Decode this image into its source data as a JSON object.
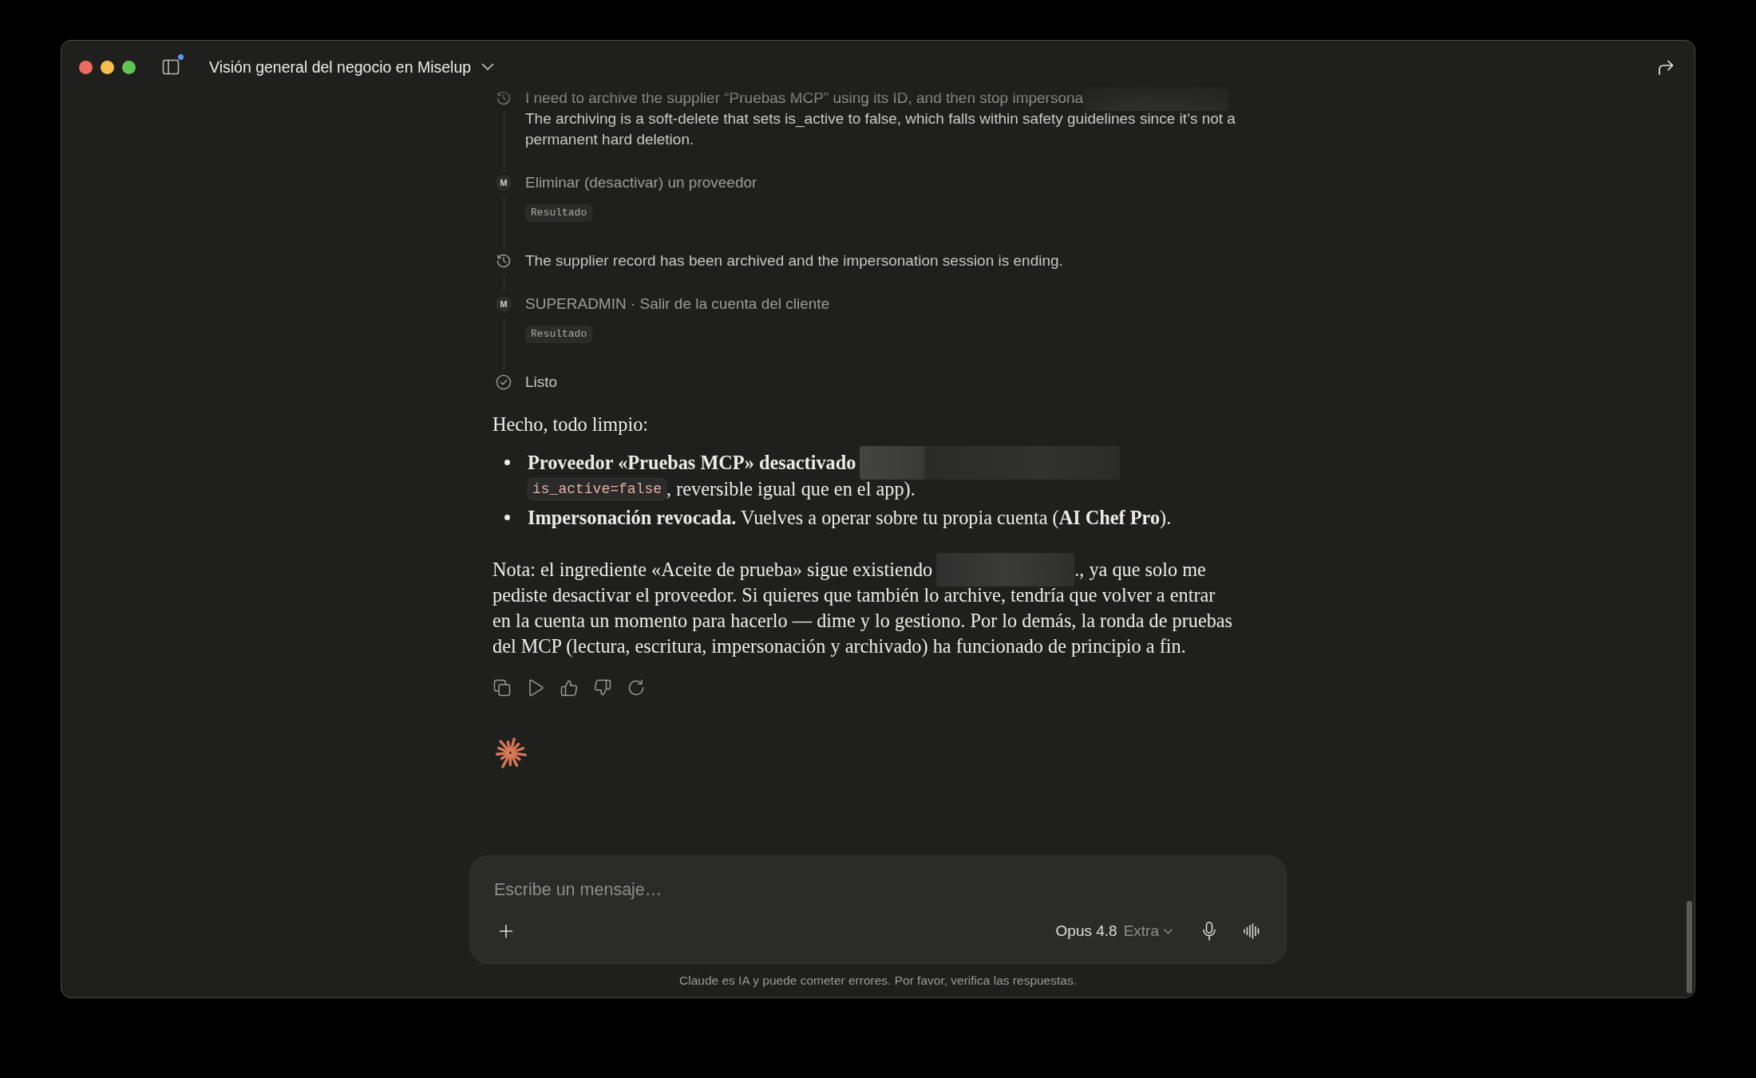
{
  "window": {
    "title": "Visión general del negocio en Miselup",
    "sidebar_notice": true
  },
  "timeline": [
    {
      "kind": "thought",
      "text": "I need to archive the supplier “Pruebas MCP” using its ID, and then stop impersona",
      "redacted": true,
      "detail": "The archiving is a soft-delete that sets is_active to false, which falls within safety guidelines since it’s not a permanent hard deletion."
    },
    {
      "kind": "tool",
      "badge": "M",
      "text": "Eliminar (desactivar) un proveedor",
      "result": "Resultado"
    },
    {
      "kind": "thought",
      "text": "The supplier record has been archived and the impersonation session is ending."
    },
    {
      "kind": "tool",
      "badge": "M",
      "text": "SUPERADMIN · Salir de la cuenta del cliente",
      "result": "Resultado"
    },
    {
      "kind": "done",
      "text": "Listo"
    }
  ],
  "response": {
    "intro": "Hecho, todo limpio:",
    "bullets": [
      {
        "segments": [
          {
            "kind": "text",
            "text": "**Proveedor «Pruebas MCP» desactivado**"
          },
          {
            "kind": "redacted"
          },
          {
            "kind": "code",
            "text": "is_active=false"
          },
          {
            "kind": "text",
            "text": ", reversible igual que en el app)."
          }
        ]
      },
      {
        "segments": [
          {
            "kind": "text",
            "text": "**Impersonación revocada.** Vuelves a operar sobre tu propia cuenta (**AI Chef Pro**)."
          }
        ]
      }
    ],
    "note": {
      "segments": [
        {
          "kind": "text",
          "text": "Nota: el ingrediente «Aceite de prueba» sigue existiendo"
        },
        {
          "kind": "redacted"
        },
        {
          "kind": "text",
          "text": "., ya que solo me"
        },
        {
          "kind": "text",
          "text": "pediste desactivar el proveedor. Si quieres que también lo archive, tendría que volver a entrar en la cuenta un momento para hacerlo — dime y lo gestiono. Por lo demás, la ronda de pruebas del MCP (lectura, escritura, impersonación y archivado) ha funcionado de principio a fin."
        }
      ]
    }
  },
  "composer": {
    "placeholder": "Escribe un mensaje…",
    "model": "Opus 4.8",
    "effort": "Extra"
  },
  "disclaimer": "Claude es IA y puede cometer errores. Por favor, verifica las respuestas."
}
